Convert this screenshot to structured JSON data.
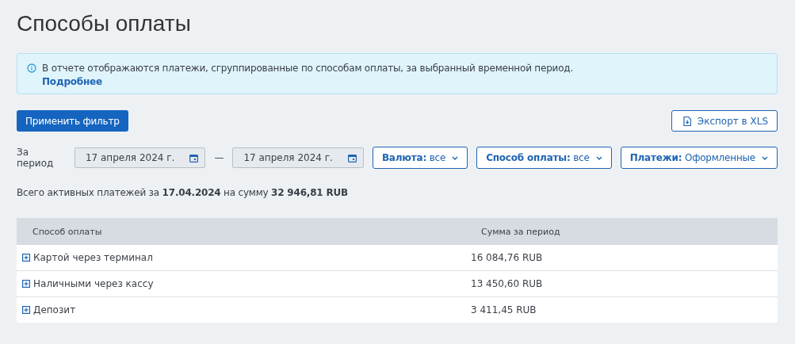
{
  "page": {
    "title": "Способы оплаты"
  },
  "info": {
    "text": "В отчете отображаются платежи, сгруппированные по способам оплаты, за выбранный временной период.",
    "link": "Подробнее"
  },
  "actions": {
    "apply": "Применить фильтр",
    "export": "Экспорт в XLS"
  },
  "period": {
    "label": "За период",
    "from": "17 апреля 2024 г.",
    "separator": "—",
    "to": "17 апреля 2024 г."
  },
  "filters": [
    {
      "label": "Валюта:",
      "value": "все"
    },
    {
      "label": "Способ оплаты:",
      "value": "все"
    },
    {
      "label": "Платежи:",
      "value": "Оформленные"
    }
  ],
  "summary": "Всего активных платежей за **17.04.2024** на сумму **32 946,81 RUB**",
  "table": {
    "columns": [
      "Способ оплаты",
      "Сумма за период"
    ],
    "rows": [
      {
        "method": "Картой через терминал",
        "amount": "16 084,76 RUB",
        "expanded": false
      },
      {
        "method": "Наличными через кассу",
        "amount": "13 450,60 RUB",
        "expanded": false
      },
      {
        "method": "Депозит",
        "amount": "3 411,45 RUB",
        "expanded": false
      }
    ]
  }
}
